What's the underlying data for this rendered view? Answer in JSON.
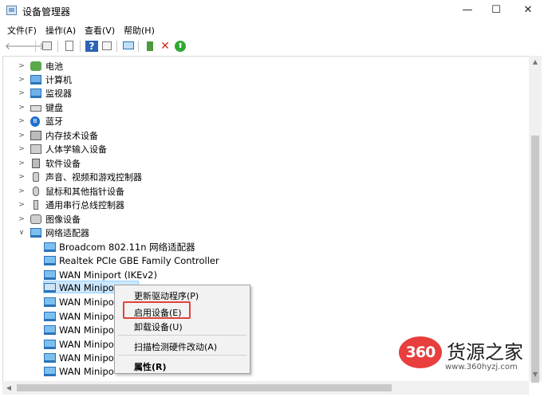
{
  "window": {
    "title": "设备管理器",
    "minimize": "—",
    "maximize": "☐",
    "close": "✕"
  },
  "menu": [
    "文件(F)",
    "操作(A)",
    "查看(V)",
    "帮助(H)"
  ],
  "toolbar": {
    "back": "🡐",
    "forward": "🡒",
    "delete": "✕",
    "enable": "⬆",
    "help": "?"
  },
  "tree_categories": [
    {
      "label": "电池",
      "icon": "battery-icon"
    },
    {
      "label": "计算机",
      "icon": "computer-icon"
    },
    {
      "label": "监视器",
      "icon": "monitor-icon"
    },
    {
      "label": "键盘",
      "icon": "keyboard-icon"
    },
    {
      "label": "蓝牙",
      "icon": "bluetooth-icon"
    },
    {
      "label": "内存技术设备",
      "icon": "memory-icon"
    },
    {
      "label": "人体学输入设备",
      "icon": "hid-icon"
    },
    {
      "label": "软件设备",
      "icon": "software-device-icon"
    },
    {
      "label": "声音、视频和游戏控制器",
      "icon": "sound-icon"
    },
    {
      "label": "鼠标和其他指针设备",
      "icon": "mouse-icon"
    },
    {
      "label": "通用串行总线控制器",
      "icon": "usb-icon"
    },
    {
      "label": "图像设备",
      "icon": "camera-icon"
    },
    {
      "label": "网络适配器",
      "icon": "network-adapter-icon"
    }
  ],
  "network_adapters": [
    "Broadcom 802.11n 网络适配器",
    "Realtek PCIe GBE Family Controller",
    "WAN Miniport (IKEv2)",
    "WAN Minipo",
    "WAN Minipo",
    "WAN Minipo",
    "WAN Minipo",
    "WAN Minipo",
    "WAN Minipo",
    "WAN Minipo"
  ],
  "context_menu": {
    "update_driver": "更新驱动程序(P)",
    "enable_device": "启用设备(E)",
    "uninstall_device": "卸载设备(U)",
    "scan_hardware": "扫描检测硬件改动(A)",
    "properties": "属性(R)"
  },
  "watermark": {
    "badge": "360",
    "title": "货源之家",
    "url": "www.360hyzj.com"
  },
  "colors": {
    "selection": "#cce8ff",
    "highlight_box": "#e0443a",
    "watermark_red": "#e83e3e"
  }
}
